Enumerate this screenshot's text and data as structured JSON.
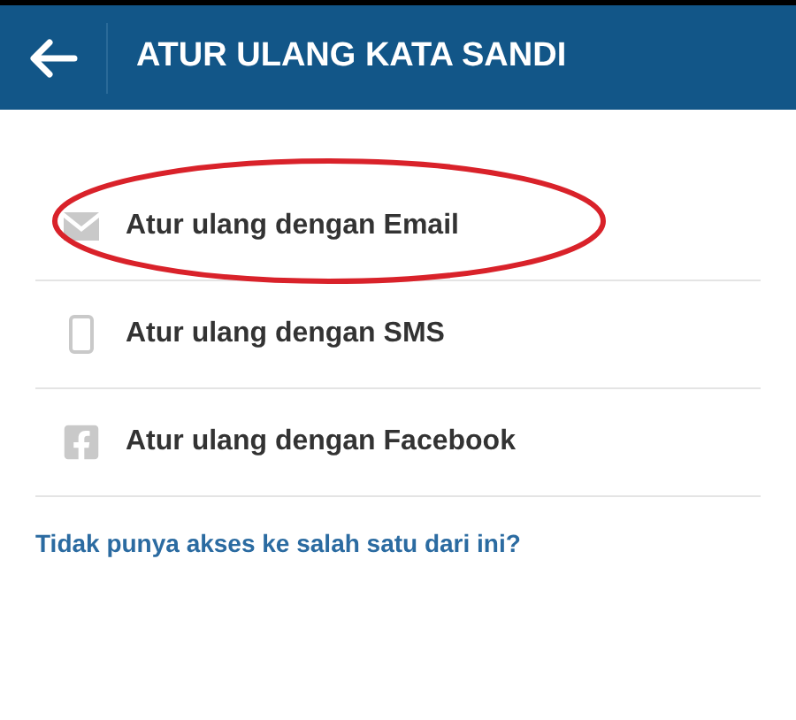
{
  "header": {
    "title": "ATUR ULANG KATA SANDI"
  },
  "options": [
    {
      "kind": "email",
      "label": "Atur ulang dengan Email",
      "circled": true
    },
    {
      "kind": "sms",
      "label": "Atur ulang dengan SMS",
      "circled": false
    },
    {
      "kind": "facebook",
      "label": "Atur ulang dengan Facebook",
      "circled": false
    }
  ],
  "help_link": "Tidak punya akses ke salah satu dari ini?"
}
